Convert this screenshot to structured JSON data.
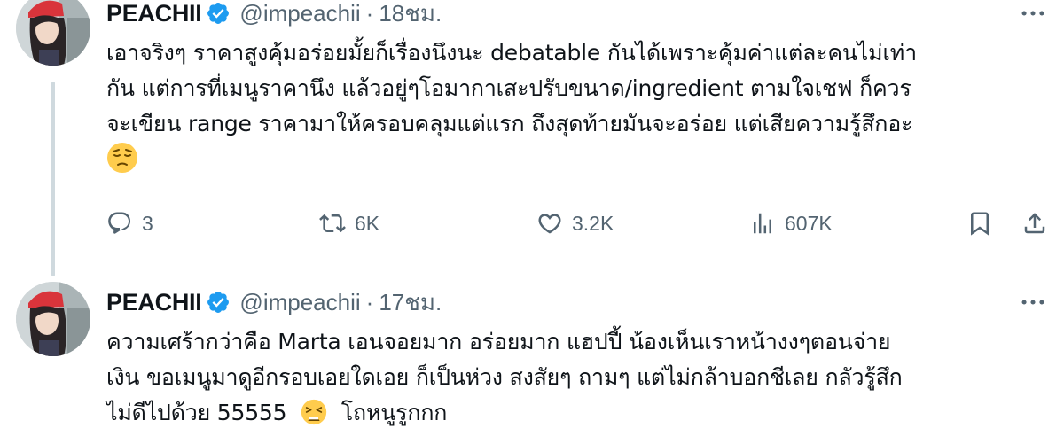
{
  "tweets": [
    {
      "display_name": "PEACHII",
      "handle": "@impeachii",
      "separator": "·",
      "time": "18ชม.",
      "text_lines": [
        "เอาจริงๆ ราคาสูงคุ้มอร่อยมั้ยก็เรื่องนึงนะ debatable กันได้เพราะคุ้มค่าแต่ละคนไม่เท่า",
        "กัน แต่การที่เมนูราคานึง แล้วอยู่ๆโอมากาเสะปรับขนาด/ingredient ตามใจเชฟ ก็ควร",
        "จะเขียน range ราคามาให้ครอบคลุมแต่แรก ถึงสุดท้ายมันจะอร่อย แต่เสียความรู้สึกอะ"
      ],
      "trailing_emoji": "pensive-face",
      "replies": "3",
      "reposts": "6K",
      "likes": "3.2K",
      "views": "607K"
    },
    {
      "display_name": "PEACHII",
      "handle": "@impeachii",
      "separator": "·",
      "time": "17ชม.",
      "text_lines": [
        "ความเศร้ากว่าคือ Marta เอนจอยมาก อร่อยมาก แฮปปี้ น้องเห็นเราหน้างงๆตอนจ่าย",
        "เงิน ขอเมนูมาดูอีกรอบเอยใดเอย ก็เป็นห่วง สงสัยๆ ถามๆ แต่ไม่กล้าบอกชีเลย กลัวรู้สึก",
        "ไม่ดีไปด้วย 55555",
        "โถหนูรูกกก"
      ],
      "inline_emoji": "tired-face"
    }
  ],
  "icons": {
    "verified": "verified-badge-icon",
    "more": "more-options-icon",
    "reply": "reply-icon",
    "repost": "repost-icon",
    "like": "like-icon",
    "views": "views-icon",
    "bookmark": "bookmark-icon",
    "share": "share-icon"
  },
  "colors": {
    "verified_blue": "#1d9bf0",
    "secondary_text": "#536471",
    "primary_text": "#0f1419",
    "thread_line": "#cfd9de"
  }
}
